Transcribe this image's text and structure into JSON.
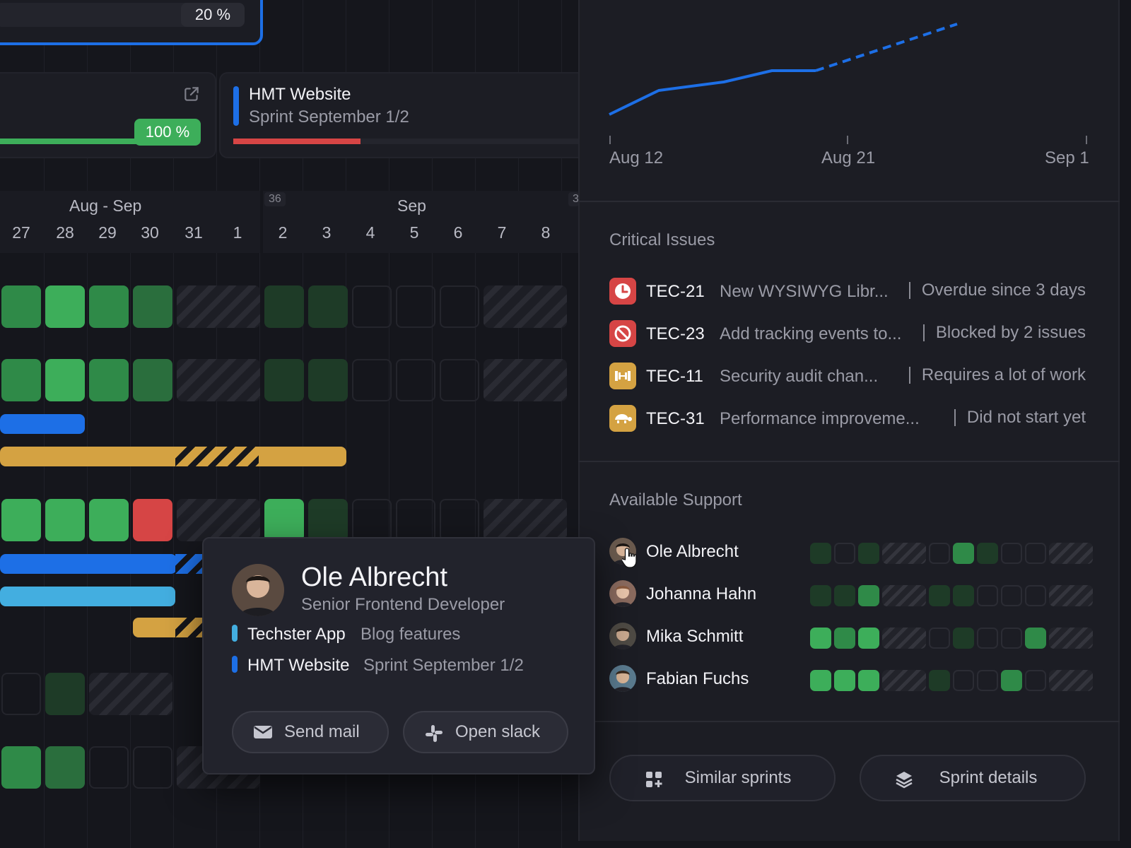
{
  "top_card": {
    "progress_label": "20 %",
    "progress": 0.2
  },
  "project_card_a": {
    "progress_label": "100 %",
    "progress": 1.0
  },
  "project_card_b": {
    "title": "HMT Website",
    "subtitle": "Sprint September 1/2",
    "progress": 0.35
  },
  "calendar": {
    "months": [
      "Aug - Sep",
      "Sep"
    ],
    "week_number": "36",
    "week_number_partial": "3",
    "days": [
      "27",
      "28",
      "29",
      "30",
      "31",
      "1",
      "2",
      "3",
      "4",
      "5",
      "6",
      "7",
      "8"
    ]
  },
  "burnup_chart": {
    "axis_labels": [
      "Aug 12",
      "Aug 21",
      "Sep 1"
    ],
    "line_color": "#1d6fe6"
  },
  "critical_issues": {
    "title": "Critical Issues",
    "items": [
      {
        "id": "TEC-21",
        "description": "New WYSIWYG Libr...",
        "status": "Overdue since 3 days",
        "icon": "clock-icon",
        "color": "#d64545"
      },
      {
        "id": "TEC-23",
        "description": "Add tracking events to...",
        "status": "Blocked by 2 issues",
        "icon": "blocked-icon",
        "color": "#d64545"
      },
      {
        "id": "TEC-11",
        "description": "Security audit chan...",
        "status": "Requires a lot of work",
        "icon": "dumbbell-icon",
        "color": "#d4a242"
      },
      {
        "id": "TEC-31",
        "description": "Performance improveme...",
        "status": "Did not start yet",
        "icon": "turtle-icon",
        "color": "#d4a242"
      }
    ]
  },
  "available_support": {
    "title": "Available Support",
    "people": [
      {
        "name": "Ole Albrecht"
      },
      {
        "name": "Johanna Hahn"
      },
      {
        "name": "Mika Schmitt"
      },
      {
        "name": "Fabian Fuchs"
      }
    ]
  },
  "actions": {
    "similar_sprints": "Similar sprints",
    "sprint_details": "Sprint details"
  },
  "popover": {
    "name": "Ole Albrecht",
    "role": "Senior Frontend Developer",
    "projects": [
      {
        "name": "Techster App",
        "sprint": "Blog features",
        "color": "#43aee0"
      },
      {
        "name": "HMT Website",
        "sprint": "Sprint September 1/2",
        "color": "#1d6fe6"
      }
    ],
    "send_mail": "Send mail",
    "open_slack": "Open slack"
  }
}
